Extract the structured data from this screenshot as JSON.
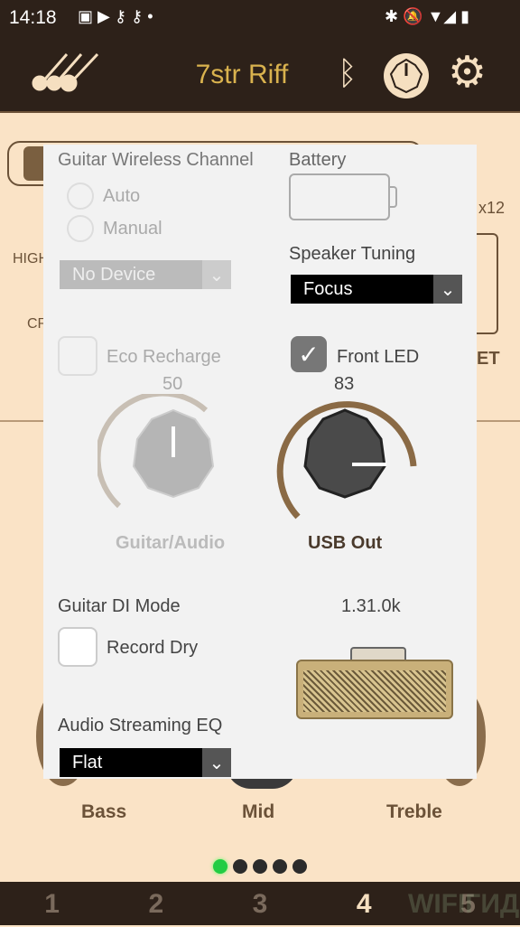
{
  "status_bar": {
    "time": "14:18",
    "icons": [
      "image-icon",
      "youtube-icon",
      "voicemail-icon",
      "voicemail-icon",
      "dot-icon",
      "bluetooth-icon",
      "notifications-off-icon",
      "wifi-icon",
      "signal-icon",
      "battery-icon"
    ]
  },
  "header": {
    "title": "7str Riff",
    "title_color": "#d9b24e",
    "icons": [
      "guitars-icon",
      "bluetooth-icon",
      "knob-icon",
      "gear-icon"
    ]
  },
  "background": {
    "texts": [
      "HIGH",
      "CR",
      "x12",
      "ET"
    ],
    "knob_labels": [
      "Bass",
      "Mid",
      "Treble"
    ]
  },
  "dialog": {
    "wireless": {
      "title": "Guitar Wireless Channel",
      "options": [
        "Auto",
        "Manual"
      ],
      "device": "No Device"
    },
    "battery": {
      "title": "Battery"
    },
    "speaker": {
      "title": "Speaker Tuning",
      "value": "Focus"
    },
    "eco": {
      "label": "Eco Recharge",
      "checked": false
    },
    "front_led": {
      "label": "Front LED",
      "checked": true
    },
    "guitar_audio": {
      "label": "Guitar/Audio",
      "value": "50"
    },
    "usb_out": {
      "label": "USB Out",
      "value": "83"
    },
    "di_mode": {
      "title": "Guitar DI Mode",
      "record_dry": "Record Dry",
      "checked": false
    },
    "version": "1.31.0k",
    "eq": {
      "title": "Audio Streaming EQ",
      "value": "Flat"
    }
  },
  "page_dots": {
    "count": 5,
    "active": 1,
    "active_color": "#22cc44"
  },
  "bottom_nav": {
    "items": [
      "1",
      "2",
      "3",
      "4",
      "5"
    ],
    "active": "4"
  },
  "watermark": "WIFIГИД"
}
